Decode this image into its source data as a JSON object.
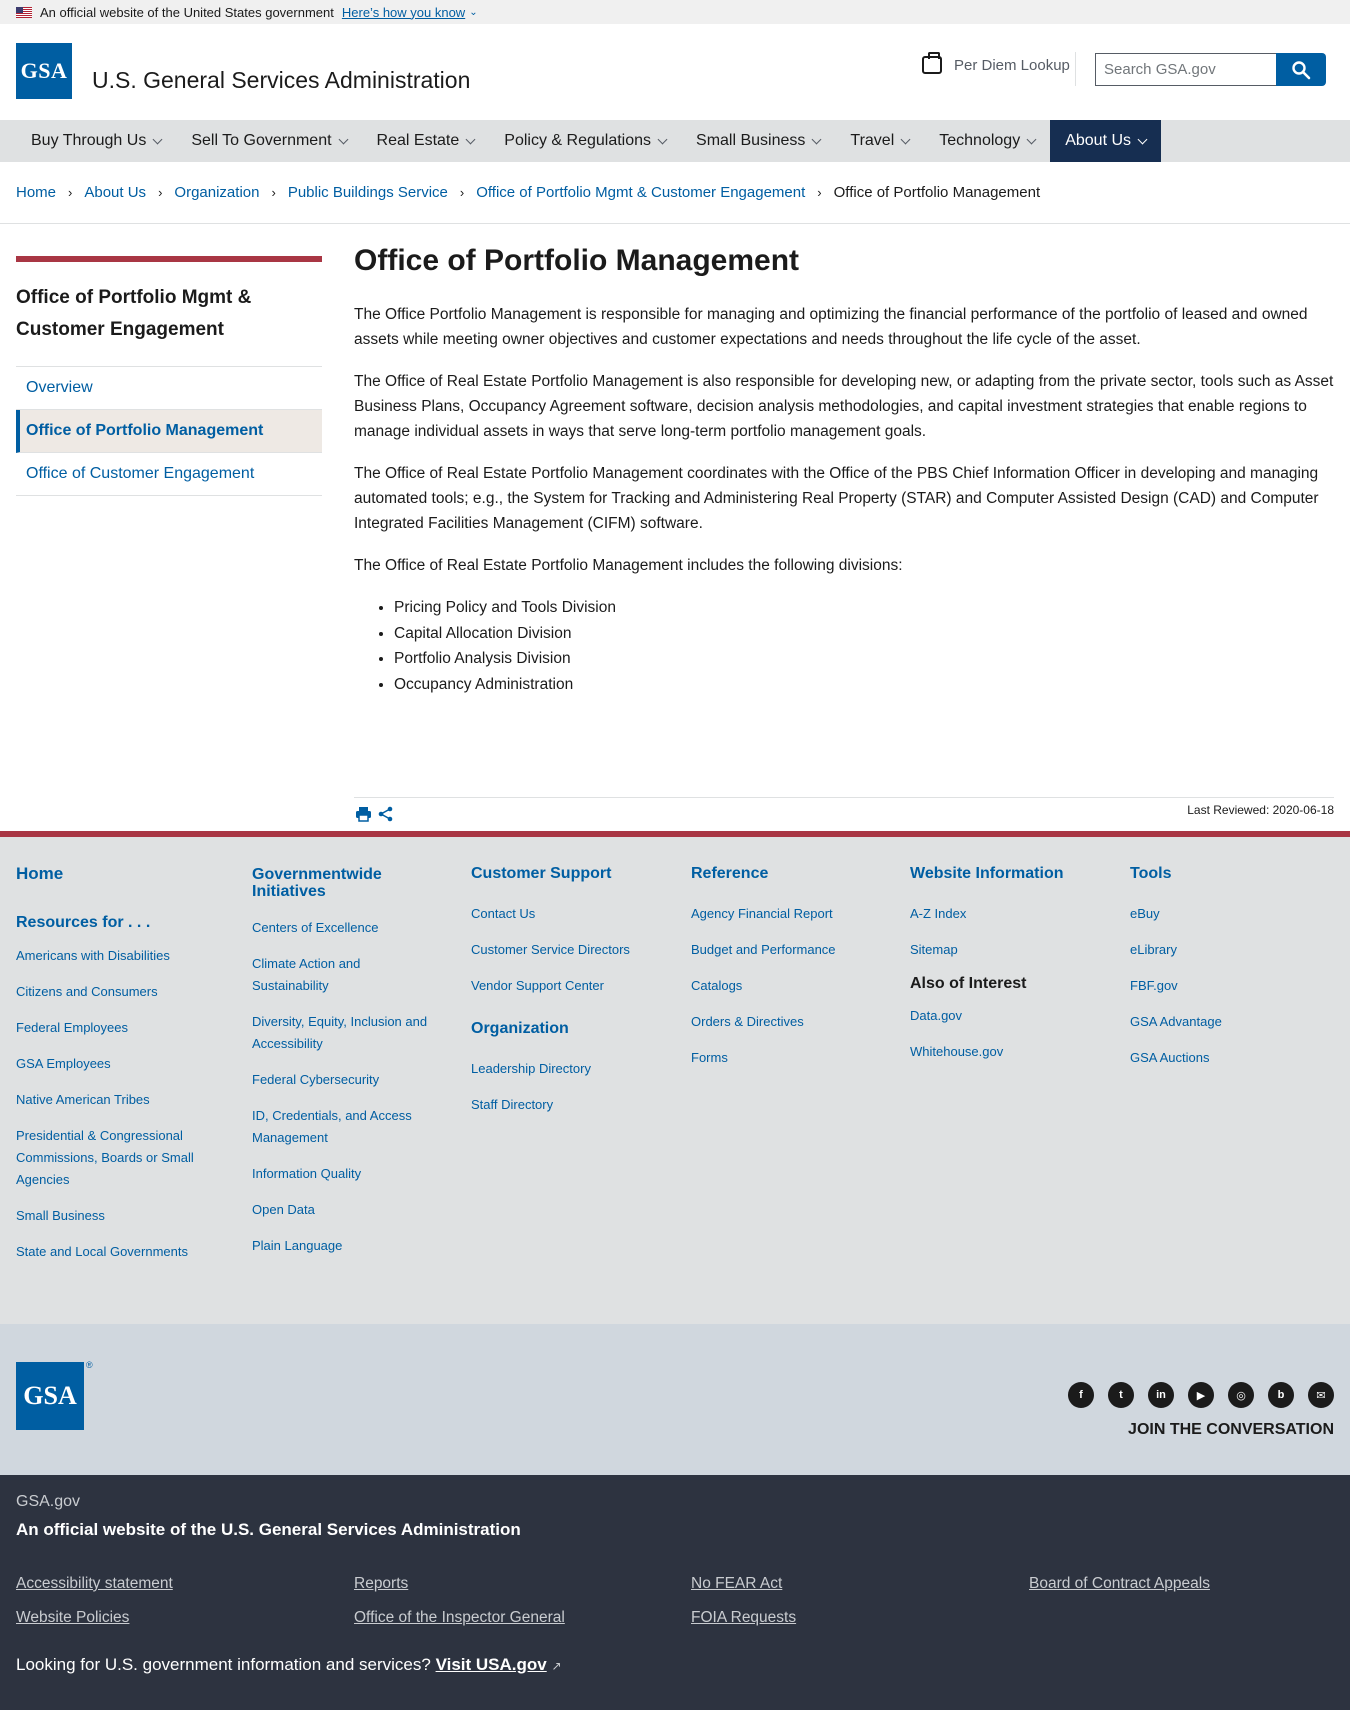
{
  "gov_banner": {
    "text": "An official website of the United States government",
    "link": "Here’s how you know"
  },
  "header": {
    "logo": "GSA",
    "agency_name": "U.S. General Services Administration",
    "per_diem": "Per Diem Lookup",
    "search_placeholder": "Search GSA.gov"
  },
  "nav": [
    {
      "label": "Buy Through Us"
    },
    {
      "label": "Sell To Government"
    },
    {
      "label": "Real Estate"
    },
    {
      "label": "Policy & Regulations"
    },
    {
      "label": "Small Business"
    },
    {
      "label": "Travel"
    },
    {
      "label": "Technology"
    },
    {
      "label": "About Us",
      "active": true
    }
  ],
  "breadcrumb": [
    "Home",
    "About Us",
    "Organization",
    "Public Buildings Service",
    "Office of Portfolio Mgmt & Customer Engagement"
  ],
  "breadcrumb_current": "Office of Portfolio Management",
  "sidebar": {
    "title": "Office of Portfolio Mgmt & Customer Engagement",
    "items": [
      {
        "label": "Overview"
      },
      {
        "label": "Office of Portfolio Management",
        "current": true
      },
      {
        "label": "Office of Customer Engagement"
      }
    ]
  },
  "main": {
    "title": "Office of Portfolio Management",
    "paragraphs": [
      "The Office Portfolio Management is responsible for managing and optimizing the financial performance of the portfolio of leased and owned assets while meeting owner objectives and customer expectations and needs throughout the life cycle of the asset.",
      "The Office of Real Estate Portfolio Management is also responsible for developing new, or adapting from the private sector, tools such as Asset Business Plans, Occupancy Agreement software, decision analysis methodologies, and capital investment strategies that enable regions to manage individual assets in ways that serve long-term portfolio management goals.",
      "The Office of Real Estate Portfolio Management coordinates with the Office of the PBS Chief Information Officer in developing and managing automated tools; e.g., the System for Tracking and Administering Real Property (STAR) and Computer Assisted Design (CAD) and Computer Integrated Facilities Management (CIFM) software.",
      "The Office of Real Estate Portfolio Management includes the following divisions:"
    ],
    "divisions": [
      "Pricing Policy and Tools Division",
      "Capital Allocation Division",
      "Portfolio Analysis Division",
      "Occupancy Administration"
    ],
    "last_reviewed": "Last Reviewed: 2020-06-18"
  },
  "footer": {
    "col1": {
      "home": "Home",
      "resources_head": "Resources for . . .",
      "links": [
        "Americans with Disabilities",
        "Citizens and Consumers",
        "Federal Employees",
        "GSA Employees",
        "Native American Tribes",
        "Presidential & Congressional Commissions, Boards or Small Agencies",
        "Small Business",
        "State and Local Governments"
      ]
    },
    "col2": {
      "head": "Governmentwide Initiatives",
      "links": [
        "Centers of Excellence",
        "Climate Action and Sustainability",
        "Diversity, Equity, Inclusion and Accessibility",
        "Federal Cybersecurity",
        "ID, Credentials, and Access Management",
        "Information Quality",
        "Open Data",
        "Plain Language"
      ]
    },
    "col3": {
      "head": "Customer Support",
      "links": [
        "Contact Us",
        "Customer Service Directors",
        "Vendor Support Center"
      ],
      "head2": "Organization",
      "links2": [
        "Leadership Directory",
        "Staff Directory"
      ]
    },
    "col4": {
      "head": "Reference",
      "links": [
        "Agency Financial Report",
        "Budget and Performance",
        "Catalogs",
        "Orders & Directives",
        "Forms"
      ]
    },
    "col5": {
      "head": "Website Information",
      "links": [
        "A-Z Index",
        "Sitemap"
      ],
      "head2": "Also of Interest",
      "links2": [
        "Data.gov",
        "Whitehouse.gov"
      ]
    },
    "col6": {
      "head": "Tools",
      "links": [
        "eBuy",
        "eLibrary",
        "FBF.gov",
        "GSA Advantage",
        "GSA Auctions"
      ]
    },
    "logo": "GSA",
    "join": "JOIN THE CONVERSATION",
    "social": [
      "facebook-icon",
      "twitter-icon",
      "linkedin-icon",
      "youtube-icon",
      "instagram-icon",
      "blog-icon",
      "email-icon"
    ],
    "site": "GSA.gov",
    "official": "An official website of the U.S. General Services Administration",
    "bottom_links": [
      "Accessibility statement",
      "Reports",
      "No FEAR Act",
      "Board of Contract Appeals",
      "Website Policies",
      "Office of the Inspector General",
      "FOIA Requests"
    ],
    "looking": "Looking for U.S. government information and services?",
    "visit": "Visit USA.gov"
  }
}
